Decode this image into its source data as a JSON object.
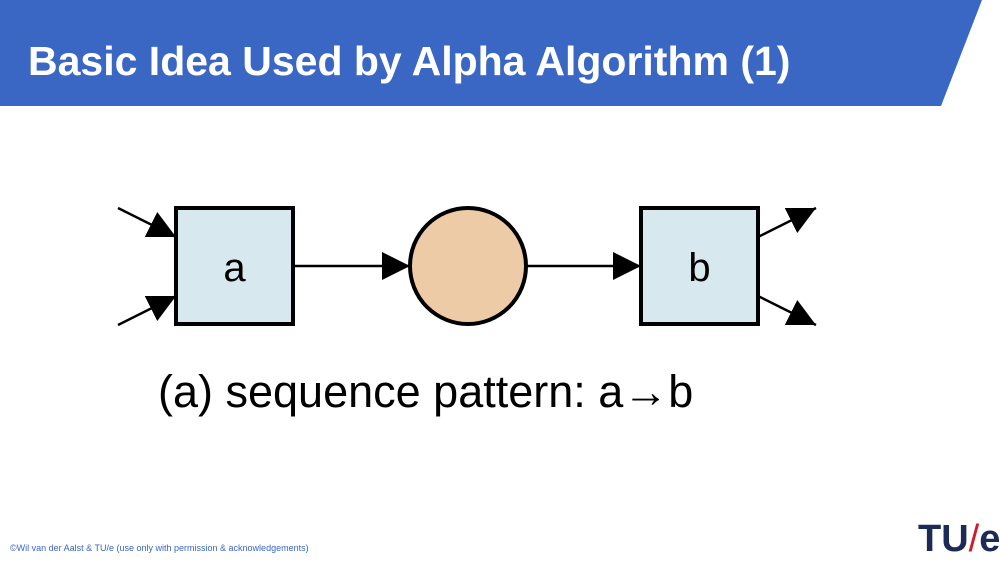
{
  "slide": {
    "title": "Basic Idea Used by Alpha Algorithm (1)",
    "caption": "(a) sequence pattern: a→b",
    "copyright": "©Wil van der Aalst & TU/e (use only with permission & acknowledgements)"
  },
  "diagram": {
    "transitions": [
      {
        "id": "a",
        "label": "a"
      },
      {
        "id": "b",
        "label": "b"
      }
    ],
    "places": [
      {
        "id": "p1",
        "label": ""
      }
    ],
    "arcs": [
      {
        "from": "input",
        "to": "a"
      },
      {
        "from": "input",
        "to": "a"
      },
      {
        "from": "a",
        "to": "p1"
      },
      {
        "from": "p1",
        "to": "b"
      },
      {
        "from": "b",
        "to": "output"
      },
      {
        "from": "b",
        "to": "output"
      }
    ]
  },
  "logo": {
    "text_part1": "TU",
    "slash": "/",
    "text_part2": "e"
  },
  "colors": {
    "header_blue": "#3a66c4",
    "transition_fill": "#d7e8ef",
    "place_fill": "#eecba7",
    "logo_navy": "#1d2a57",
    "logo_red": "#d11a2a"
  }
}
